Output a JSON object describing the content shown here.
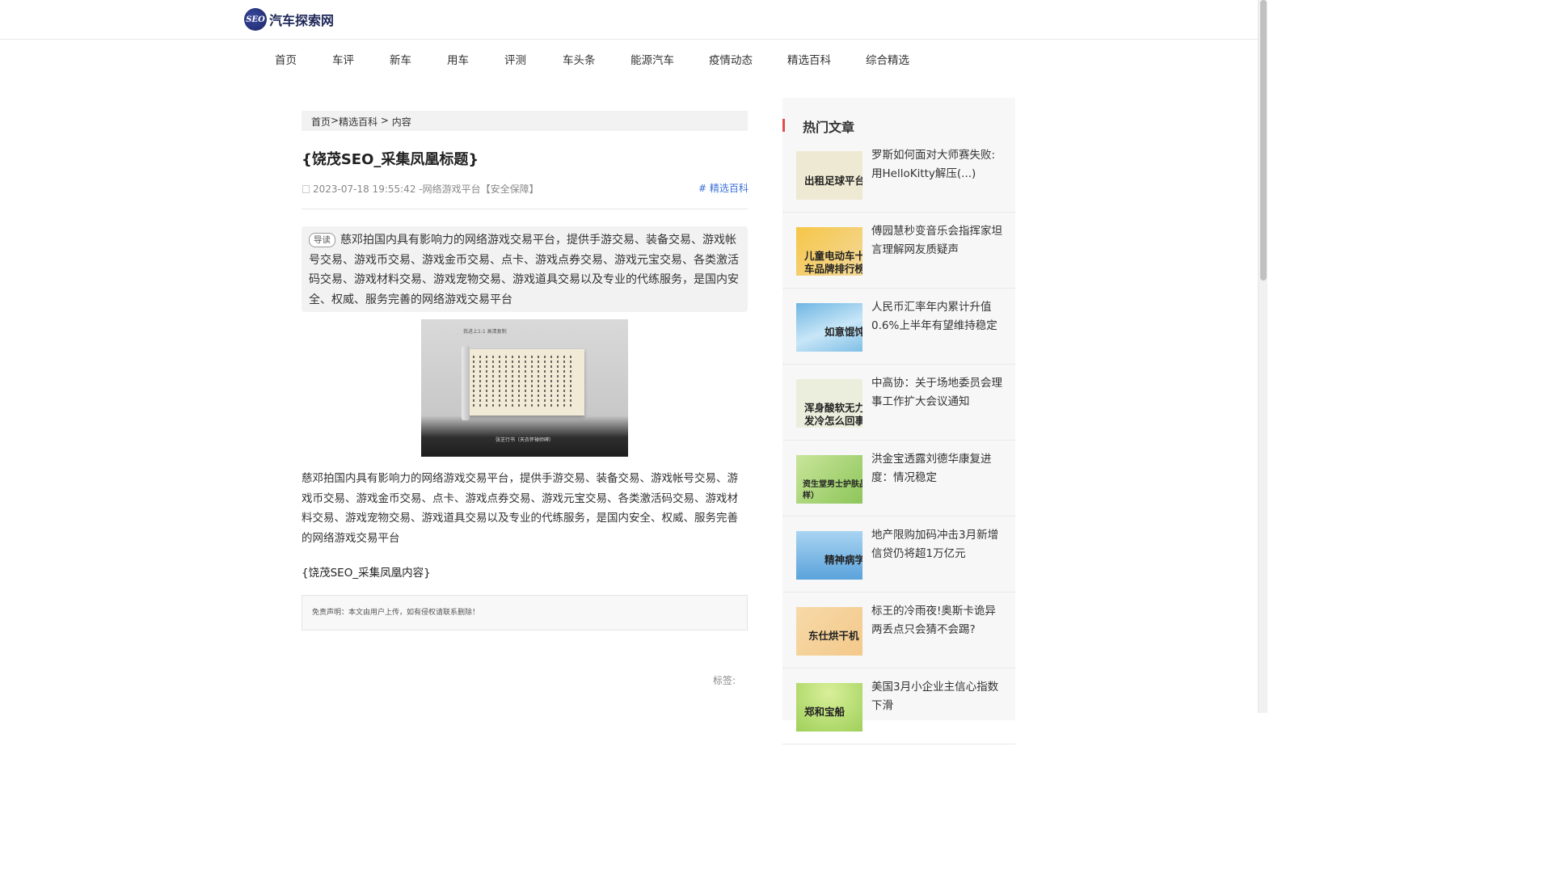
{
  "site": {
    "logo_mark": "SEO",
    "name": "汽车探索网"
  },
  "nav": [
    "首页",
    "车评",
    "新车",
    "用车",
    "评测",
    "车头条",
    "能源汽车",
    "疫情动态",
    "精选百科",
    "综合精选"
  ],
  "breadcrumb": {
    "home": "首页",
    "sep1": " >",
    "category": "精选百科",
    "sep2": " > ",
    "current": "内容"
  },
  "article": {
    "title": "{饶茂SEO_采集凤凰标题}",
    "meta": "2023-07-18 19:55:42 -网络游戏平台【安全保障】",
    "tag": "# 精选百科",
    "lead_badge": "导读",
    "lead": "慈邓拍国内具有影响力的网络游戏交易平台，提供手游交易、装备交易、游戏帐号交易、游戏币交易、游戏金币交易、点卡、游戏点券交易、游戏元宝交易、各类激活码交易、游戏材料交易、游戏宠物交易、游戏道具交易以及专业的代练服务，是国内安全、权威、服务完善的网络游戏交易平台",
    "image_top": "我进上1:1 高清复制",
    "image_caption": "张芝行书（天衣怀禅师碑）",
    "body": "慈邓拍国内具有影响力的网络游戏交易平台，提供手游交易、装备交易、游戏帐号交易、游戏币交易、游戏金币交易、点卡、游戏点券交易、游戏元宝交易、各类激活码交易、游戏材料交易、游戏宠物交易、游戏道具交易以及专业的代练服务，是国内安全、权威、服务完善的网络游戏交易平台",
    "content_placeholder": "{饶茂SEO_采集凤凰内容}",
    "disclaimer": "免责声明：本文由用户上传，如有侵权请联系删除！",
    "tags_label": "标签:"
  },
  "sidebar": {
    "title": "热门文章",
    "items": [
      {
        "thumb_text": "出租足球平台",
        "title": "罗斯如何面对大师赛失败:用HelloKitty解压(...)"
      },
      {
        "thumb_text": "儿童电动车十\n车品牌排行榜",
        "title": "傅园慧秒变音乐会指挥家坦言理解网友质疑声"
      },
      {
        "thumb_text": "如意馄饨",
        "title": "人民币汇率年内累计升值0.6%上半年有望维持稳定"
      },
      {
        "thumb_text": "浑身酸软无力\n发冷怎么回事",
        "title": "中高协：关于场地委员会理事工作扩大会议通知"
      },
      {
        "thumb_text": "资生堂男士护肤品\n样）",
        "title": "洪金宝透露刘德华康复进度：情况稳定"
      },
      {
        "thumb_text": "精神病学",
        "title": "地产限购加码冲击3月新增信贷仍将超1万亿元"
      },
      {
        "thumb_text": "东仕烘干机",
        "title": "标王的冷雨夜!奥斯卡诡异两丢点只会猜不会踢?"
      },
      {
        "thumb_text": "郑和宝船",
        "title": "美国3月小企业主信心指数下滑"
      }
    ]
  },
  "colors": {
    "accent_red": "#e34d4d",
    "link_blue": "#3a6fd8",
    "logo_navy": "#1d2757"
  }
}
